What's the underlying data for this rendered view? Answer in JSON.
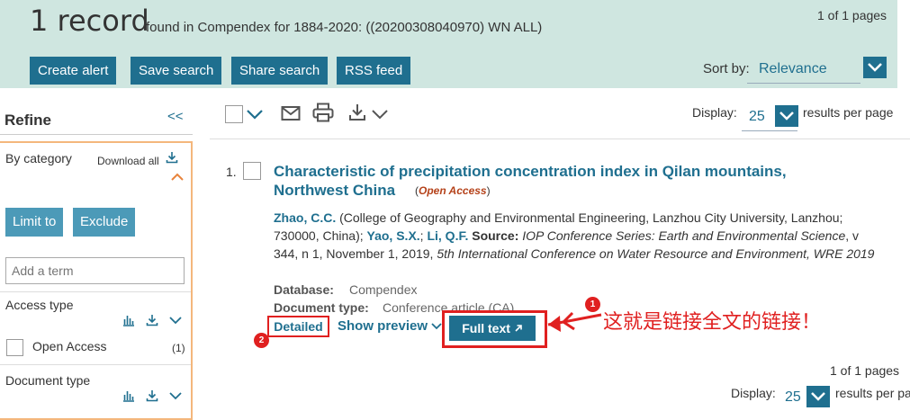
{
  "header": {
    "record_count": "1 record",
    "query_text": "found in Compendex for 1884-2020: ((20200308040970) WN ALL)",
    "pages": "1 of 1 pages",
    "buttons": {
      "create_alert": "Create alert",
      "save_search": "Save search",
      "share_search": "Share search",
      "rss_feed": "RSS feed"
    },
    "sort": {
      "label": "Sort by:",
      "value": "Relevance"
    }
  },
  "refine": {
    "title": "Refine",
    "collapse": "<<",
    "by_category": "By category",
    "download_all": "Download all",
    "limit_to": "Limit to",
    "exclude": "Exclude",
    "add_term_placeholder": "Add a term",
    "access_type": "Access type",
    "open_access_label": "Open Access",
    "open_access_count": "(1)",
    "document_type": "Document type"
  },
  "toolbar": {
    "display_label": "Display:",
    "display_value": "25",
    "results_per_page": "results per page"
  },
  "result": {
    "number": "1.",
    "title": "Characteristic of precipitation concentration index in Qilan mountains, Northwest China",
    "access_badge": "Open Access",
    "author1": "Zhao, C.C.",
    "affiliation": " (College of Geography and Environmental Engineering, Lanzhou City University, Lanzhou; 730000, China); ",
    "author2": "Yao, S.X.",
    "author3": "Li, Q.F.",
    "source_label": " Source: ",
    "source_title": "IOP Conference Series: Earth and Environmental Science",
    "source_details": ", v 344, n 1, November 1, 2019, ",
    "conference": "5th International Conference on Water Resource and Environment, WRE 2019",
    "database_label": "Database:",
    "database_value": "Compendex",
    "doctype_label": "Document type:",
    "doctype_value": "Conference article (CA)",
    "detailed": "Detailed",
    "show_preview": "Show preview",
    "full_text": "Full text"
  },
  "annotation": {
    "badge1": "1",
    "badge2": "2",
    "text": "这就是链接全文的链接！"
  },
  "footer": {
    "pages": "1 of 1 pages",
    "display_label": "Display:",
    "display_value": "25",
    "results_per_page": "results per page"
  },
  "colors": {
    "header_bg": "#cfe6e0",
    "primary": "#1f6f8f",
    "light_button": "#4c9ab8",
    "highlight_red": "#e02020",
    "refine_border": "#f4b77c"
  }
}
